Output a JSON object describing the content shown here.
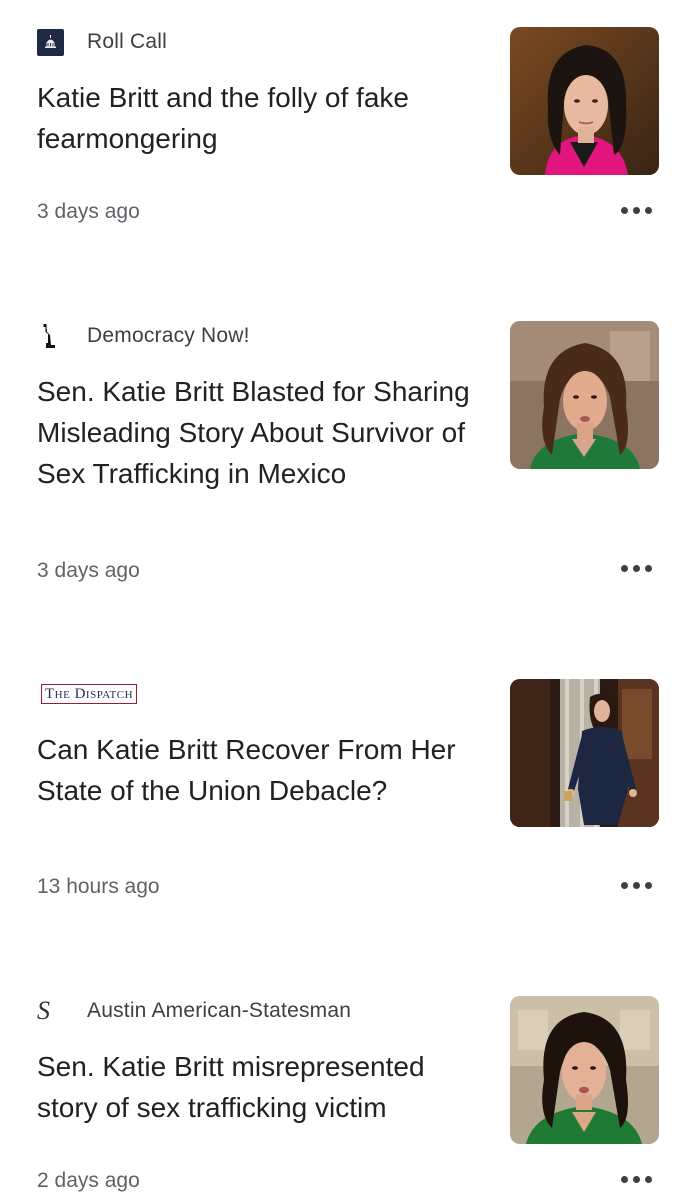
{
  "articles": [
    {
      "source": "Roll Call",
      "source_logo_icon": "capitol-dome-icon",
      "headline": "Katie Britt and the folly of fake fearmongering",
      "timestamp": "3 days ago",
      "thumbnail": "woman-dark-hair-pink-jacket-portrait",
      "more_icon": "more-horizontal-icon"
    },
    {
      "source": "Democracy Now!",
      "source_logo_icon": "statue-of-liberty-icon",
      "headline": "Sen. Katie Britt Blasted for Sharing Misleading Story About Survivor of Sex Trafficking in Mexico",
      "timestamp": "3 days ago",
      "thumbnail": "woman-green-top-speaking-portrait",
      "more_icon": "more-horizontal-icon"
    },
    {
      "source": "",
      "source_logo_text": "The Dispatch",
      "source_logo_icon": "the-dispatch-wordmark",
      "headline": "Can Katie Britt Recover From Her State of the Union Debacle?",
      "timestamp": "13 hours ago",
      "thumbnail": "woman-navy-dress-walking-hallway",
      "more_icon": "more-horizontal-icon"
    },
    {
      "source": "Austin American-Statesman",
      "source_logo_text": "S",
      "source_logo_icon": "statesman-s-icon",
      "headline": "Sen. Katie Britt misrepresented story of sex trafficking victim",
      "timestamp": "2 days ago",
      "thumbnail": "woman-green-top-kitchen-portrait",
      "more_icon": "more-horizontal-icon"
    }
  ]
}
